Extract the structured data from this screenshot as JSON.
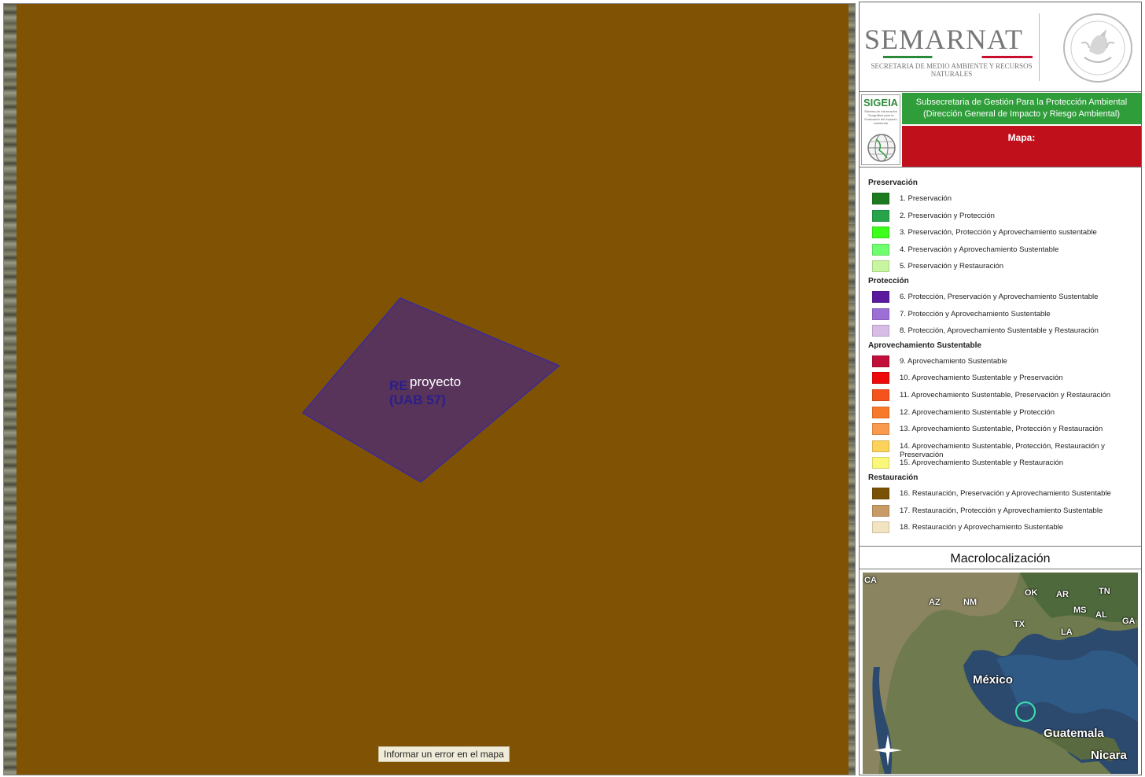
{
  "map": {
    "project_label": "proyecto",
    "zone_label_line1": "RE",
    "zone_label_line2": "(UAB 57)",
    "report_error_button": "Informar un error en el mapa",
    "zone_fill_color": "#805204",
    "project_fill_color": "#553360",
    "project_stroke_color": "#3a2a9a"
  },
  "header": {
    "org_title": "SEMARNAT",
    "org_subtitle": "SECRETARIA DE MEDIO AMBIENTE Y RECURSOS NATURALES",
    "seal_icon": "coat-of-arms-seal",
    "sigeia_label": "SIGEIA",
    "sigeia_tiny_text": "Sistema de Información Geográfica para la Evaluación del Impacto Ambiental",
    "subsecretaria": "Subsecretaria de Gestión Para la Protección Ambiental",
    "direccion": "(Dirección General de Impacto y Riesgo Ambiental)",
    "map_title": "Mapa:",
    "green_color": "#2f9e3a",
    "red_color": "#c0101c"
  },
  "legend": {
    "groups": [
      {
        "title": "Preservación",
        "items": [
          {
            "label": "1. Preservación",
            "color": "#1e7a1e"
          },
          {
            "label": "2. Preservación y Protección",
            "color": "#27a34a"
          },
          {
            "label": "3. Preservación, Protección y Aprovechamiento sustentable",
            "color": "#3cff1c"
          },
          {
            "label": "4. Preservación y Aprovechamiento Sustentable",
            "color": "#6fff6f"
          },
          {
            "label": "5. Preservación y Restauración",
            "color": "#c8f5a0"
          }
        ]
      },
      {
        "title": "Protección",
        "items": [
          {
            "label": "6. Protección, Preservación y Aprovechamiento Sustentable",
            "color": "#5b1a9e"
          },
          {
            "label": "7. Protección y Aprovechamiento Sustentable",
            "color": "#9d6ed6"
          },
          {
            "label": "8. Protección, Aprovechamiento Sustentable y Restauración",
            "color": "#d7bde6"
          }
        ]
      },
      {
        "title": "Aprovechamiento Sustentable",
        "items": [
          {
            "label": "9. Aprovechamiento Sustentable",
            "color": "#c0103a"
          },
          {
            "label": "10. Aprovechamiento Sustentable y Preservación",
            "color": "#ee0a0a"
          },
          {
            "label": "11. Aprovechamiento Sustentable, Preservación y Restauración",
            "color": "#f5521e"
          },
          {
            "label": "12. Aprovechamiento Sustentable y Protección",
            "color": "#f77a2a"
          },
          {
            "label": "13. Aprovechamiento Sustentable, Protección y Restauración",
            "color": "#fa9a4e"
          },
          {
            "label": "14. Aprovechamiento Sustentable, Protección, Restauración y Preservación",
            "color": "#fbd25a"
          },
          {
            "label": "15. Aprovechamiento Sustentable y Restauración",
            "color": "#fbf77a"
          }
        ]
      },
      {
        "title": "Restauración",
        "items": [
          {
            "label": "16. Restauración, Preservación y Aprovechamiento Sustentable",
            "color": "#7a5206"
          },
          {
            "label": "17. Restauración, Protección y Aprovechamiento Sustentable",
            "color": "#c89a66"
          },
          {
            "label": "18. Restauración y Aprovechamiento Sustentable",
            "color": "#f2e4c0"
          }
        ]
      }
    ]
  },
  "macro": {
    "title": "Macrolocalización",
    "labels": [
      "CA",
      "AZ",
      "NM",
      "OK",
      "AR",
      "TN",
      "MS",
      "AL",
      "GA",
      "TX",
      "LA",
      "México",
      "Guatemala",
      "Nicara"
    ],
    "compass_icon": "compass-rose-icon"
  }
}
